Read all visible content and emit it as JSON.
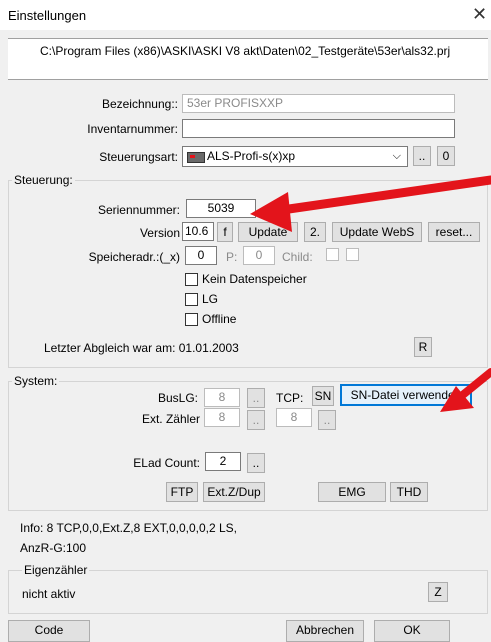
{
  "window": {
    "title": "Einstellungen",
    "close_glyph": "✕"
  },
  "project_path": "C:\\Program Files (x86)\\ASKI\\ASKI V8 akt\\Daten\\02_Testgeräte\\53er\\als32.prj",
  "device": {
    "bezeichnung_label": "Bezeichnung::",
    "bezeichnung_value": "53er PROFISXXP",
    "inventar_label": "Inventarnummer:",
    "inventar_value": "",
    "steuerungsart_label": "Steuerungsart:",
    "steuerungsart_value": "ALS-Profi-s(x)xp",
    "dots_label": "..",
    "zero_label": "0"
  },
  "steuerung": {
    "title": "Steuerung:",
    "serial_label": "Seriennummer:",
    "serial_value": "5039",
    "version_label": "Version",
    "version_value": "10.6",
    "f_button": "f",
    "update_button": "Update",
    "two_button": "2.",
    "update_webs_button": "Update WebS",
    "reset_button": "reset...",
    "speicheradr_label": "Speicheradr.:(_x)",
    "speicheradr_value": "0",
    "p_label": "P:",
    "p_value": "0",
    "child_label": "Child:",
    "checkboxes": [
      {
        "label": "Kein Datenspeicher",
        "checked": false
      },
      {
        "label": "LG",
        "checked": false
      },
      {
        "label": "Offline",
        "checked": false
      }
    ],
    "last_sync": "Letzter Abgleich war am: 01.01.2003",
    "r_button": "R"
  },
  "system": {
    "title": "System:",
    "buslg_label": "BusLG:",
    "buslg_value": "8",
    "dots_label": "..",
    "tcp_label": "TCP:",
    "sn_button": "SN",
    "sn_file_button": "SN-Datei verwenden",
    "ext_label": "Ext. Zähler",
    "ext_value1": "8",
    "ext_value2": "8",
    "elad_label": "ELad Count:",
    "elad_value": "2",
    "ftp_button": "FTP",
    "extz_button": "Ext.Z/Dup",
    "emg_button": "EMG",
    "thd_button": "THD"
  },
  "info": {
    "line1": "Info:   8 TCP,0,0,Ext.Z,8 EXT,0,0,0,0,2 LS,",
    "line2": "AnzR-G:100"
  },
  "eigenzaehler": {
    "title": "Eigenzähler",
    "status": "nicht aktiv",
    "z_button": "Z"
  },
  "footer": {
    "code_button": "Code",
    "cancel_button": "Abbrechen",
    "ok_button": "OK"
  },
  "colors": {
    "arrow": "#e3141b",
    "focus": "#0078d7"
  }
}
